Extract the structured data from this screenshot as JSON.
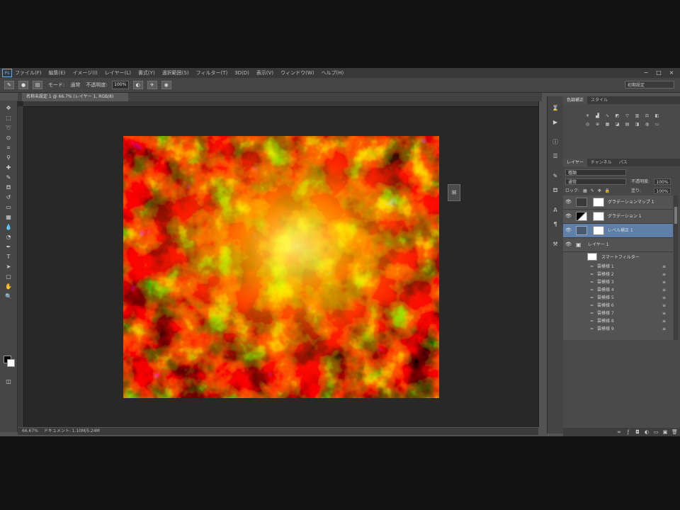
{
  "app": {
    "logo": "Ps"
  },
  "menu": [
    "ファイル(F)",
    "編集(E)",
    "イメージ(I)",
    "レイヤー(L)",
    "書式(Y)",
    "選択範囲(S)",
    "フィルター(T)",
    "3D(D)",
    "表示(V)",
    "ウィンドウ(W)",
    "ヘルプ(H)"
  ],
  "window_controls": [
    "−",
    "□",
    "×"
  ],
  "options_bar": {
    "mode_label": "モード:",
    "mode_value": "通常",
    "opacity_label": "不透明度:",
    "opacity_value": "100%"
  },
  "workspace": "初期設定",
  "document_tab": "名称未設定 1 @ 66.7% (レイヤー 1, RGB/8)",
  "status": {
    "zoom": "66.67%",
    "doc": "ドキュメント: 1.10M/5.24M"
  },
  "adjustments": {
    "tabs": [
      "色調補正",
      "スタイル"
    ]
  },
  "layers_panel": {
    "tabs": [
      "レイヤー",
      "チャンネル",
      "パス"
    ],
    "kind_filter": "種類",
    "blend_mode": "通常",
    "opacity_label": "不透明度:",
    "opacity_value": "100%",
    "lock_label": "ロック:",
    "fill_label": "塗り:",
    "fill_value": "100%",
    "layers": [
      {
        "name": "グラデーションマップ 1",
        "visible": true
      },
      {
        "name": "グラデーション 1",
        "visible": true
      },
      {
        "name": "レベル補正 1",
        "visible": true,
        "selected": true
      },
      {
        "name": "レイヤー 1",
        "visible": true,
        "group": true
      }
    ],
    "effects_header": "スマートフィルター",
    "effects": [
      "雲模様 1",
      "雲模様 2",
      "雲模様 3",
      "雲模様 4",
      "雲模様 5",
      "雲模様 6",
      "雲模様 7",
      "雲模様 8",
      "雲模様 9"
    ]
  }
}
